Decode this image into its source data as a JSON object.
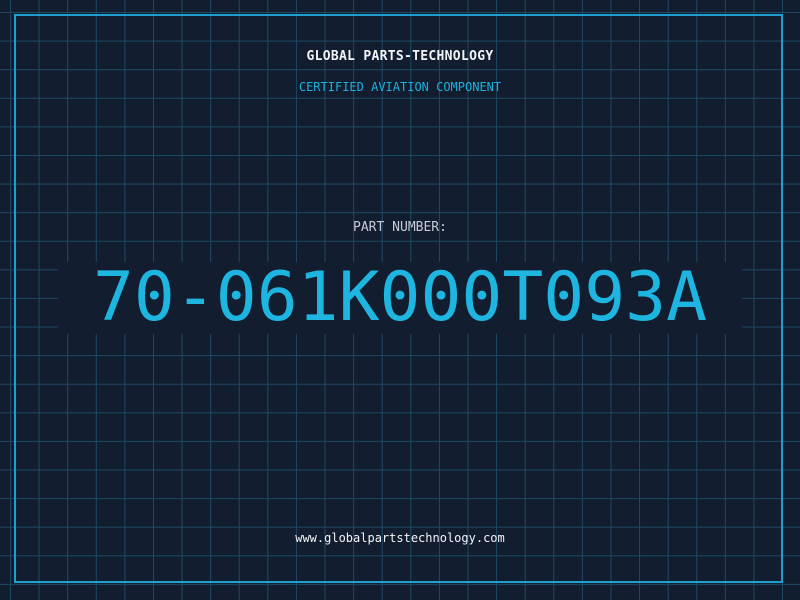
{
  "header": {
    "company": "GLOBAL PARTS-TECHNOLOGY",
    "subtitle": "CERTIFIED AVIATION COMPONENT"
  },
  "part": {
    "label": "PART NUMBER:",
    "number": "70-061K000T093A"
  },
  "footer": {
    "url": "www.globalpartstechnology.com"
  },
  "colors": {
    "background": "#121d30",
    "grid": "#1d4a63",
    "accent": "#1eb6e0",
    "text": "#f2f4f7"
  }
}
